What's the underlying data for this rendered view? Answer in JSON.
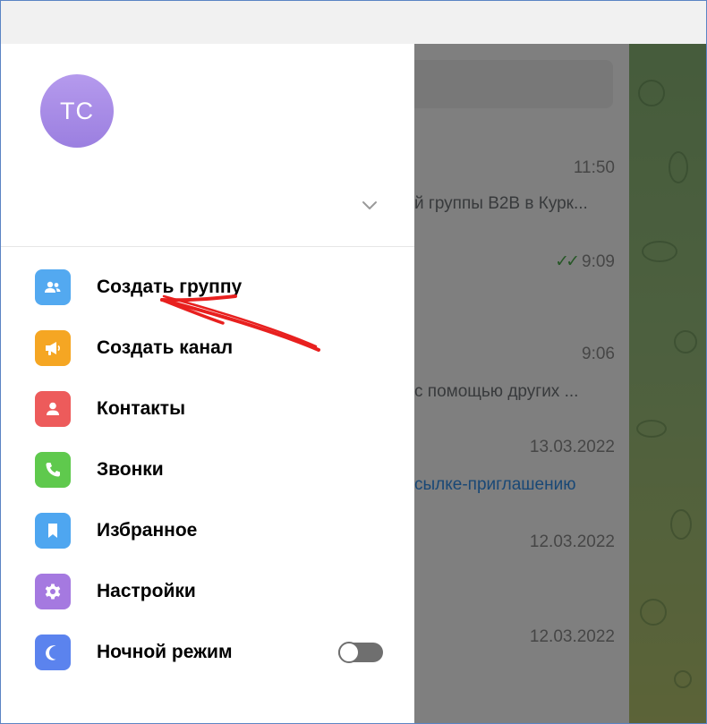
{
  "user": {
    "initials": "TC",
    "avatar_color": "#a98ee8"
  },
  "chats": [
    {
      "time": "11:50",
      "preview": "й группы B2B в Курк...",
      "read": false
    },
    {
      "time": "9:09",
      "preview": "",
      "read": true
    },
    {
      "time": "9:06",
      "preview": "с помощью других ...",
      "read": false
    },
    {
      "time": "13.03.2022",
      "preview": "сылке-приглашению",
      "read": false
    },
    {
      "time": "12.03.2022",
      "preview": "",
      "read": false
    },
    {
      "time": "12.03.2022",
      "preview": "",
      "read": false
    }
  ],
  "menu": [
    {
      "label": "Создать группу",
      "icon": "group-icon",
      "color": "#53a9f0"
    },
    {
      "label": "Создать канал",
      "icon": "megaphone-icon",
      "color": "#f5a623"
    },
    {
      "label": "Контакты",
      "icon": "contact-icon",
      "color": "#ed5b5b"
    },
    {
      "label": "Звонки",
      "icon": "phone-icon",
      "color": "#5fc94d"
    },
    {
      "label": "Избранное",
      "icon": "bookmark-icon",
      "color": "#4ea6f0"
    },
    {
      "label": "Настройки",
      "icon": "gear-icon",
      "color": "#a579e0"
    },
    {
      "label": "Ночной режим",
      "icon": "moon-icon",
      "color": "#5b83ee"
    }
  ],
  "night_mode": {
    "enabled": false
  },
  "colors": {
    "accent": "#3390ec",
    "read_check": "#4fae4e",
    "annotation": "#e8201f"
  }
}
